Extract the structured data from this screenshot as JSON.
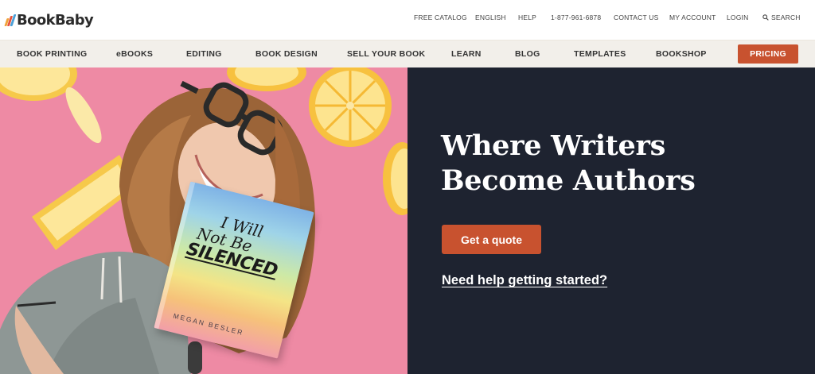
{
  "brand": {
    "name": "BookBaby",
    "bar_colors": [
      "#f0a33a",
      "#e8533b",
      "#4aa0d8"
    ]
  },
  "utility_nav": {
    "items": [
      "FREE CATALOG",
      "ENGLISH",
      "HELP",
      "1-877-961-6878",
      "CONTACT US",
      "MY ACCOUNT",
      "LOGIN"
    ],
    "search_label": "SEARCH",
    "search_icon": "magnifier"
  },
  "main_nav": {
    "items": [
      "BOOK PRINTING",
      "eBOOKS",
      "EDITING",
      "BOOK DESIGN",
      "SELL YOUR BOOK",
      "LEARN",
      "BLOG",
      "TEMPLATES",
      "BOOKSHOP"
    ],
    "pricing_label": "PRICING"
  },
  "hero": {
    "headline_line1": "Where Writers",
    "headline_line2": "Become Authors",
    "cta_label": "Get a quote",
    "help_link": "Need help getting started?",
    "book": {
      "title_line1": "I Will",
      "title_line2": "Not Be",
      "title_line3": "SILENCED",
      "author": "MEGAN BESLER"
    }
  },
  "colors": {
    "accent": "#c8522f",
    "hero_panel": "#1e2330",
    "nav_bg": "#f2efea",
    "photo_bg": "#ee8aa4"
  }
}
